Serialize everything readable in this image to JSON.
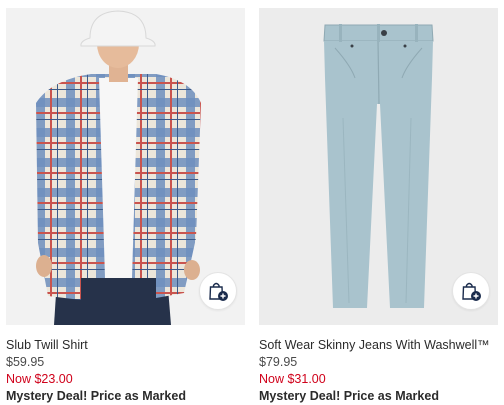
{
  "products": [
    {
      "name": "Slub Twill Shirt",
      "original_price": "$59.95",
      "sale_price": "Now $23.00",
      "promo": "Mystery Deal! Price as Marked",
      "image_icon": "plaid-shirt-model-photo"
    },
    {
      "name": "Soft Wear Skinny Jeans With Washwell™",
      "original_price": "$79.95",
      "sale_price": "Now $31.00",
      "promo": "Mystery Deal! Price as Marked",
      "image_icon": "light-blue-jeans-photo"
    }
  ],
  "quick_add_icon": "shopping-bag-plus-icon",
  "colors": {
    "sale_price": "#d0021b",
    "jeans": "#a9c3cd",
    "icon_navy": "#1a2b4c"
  }
}
